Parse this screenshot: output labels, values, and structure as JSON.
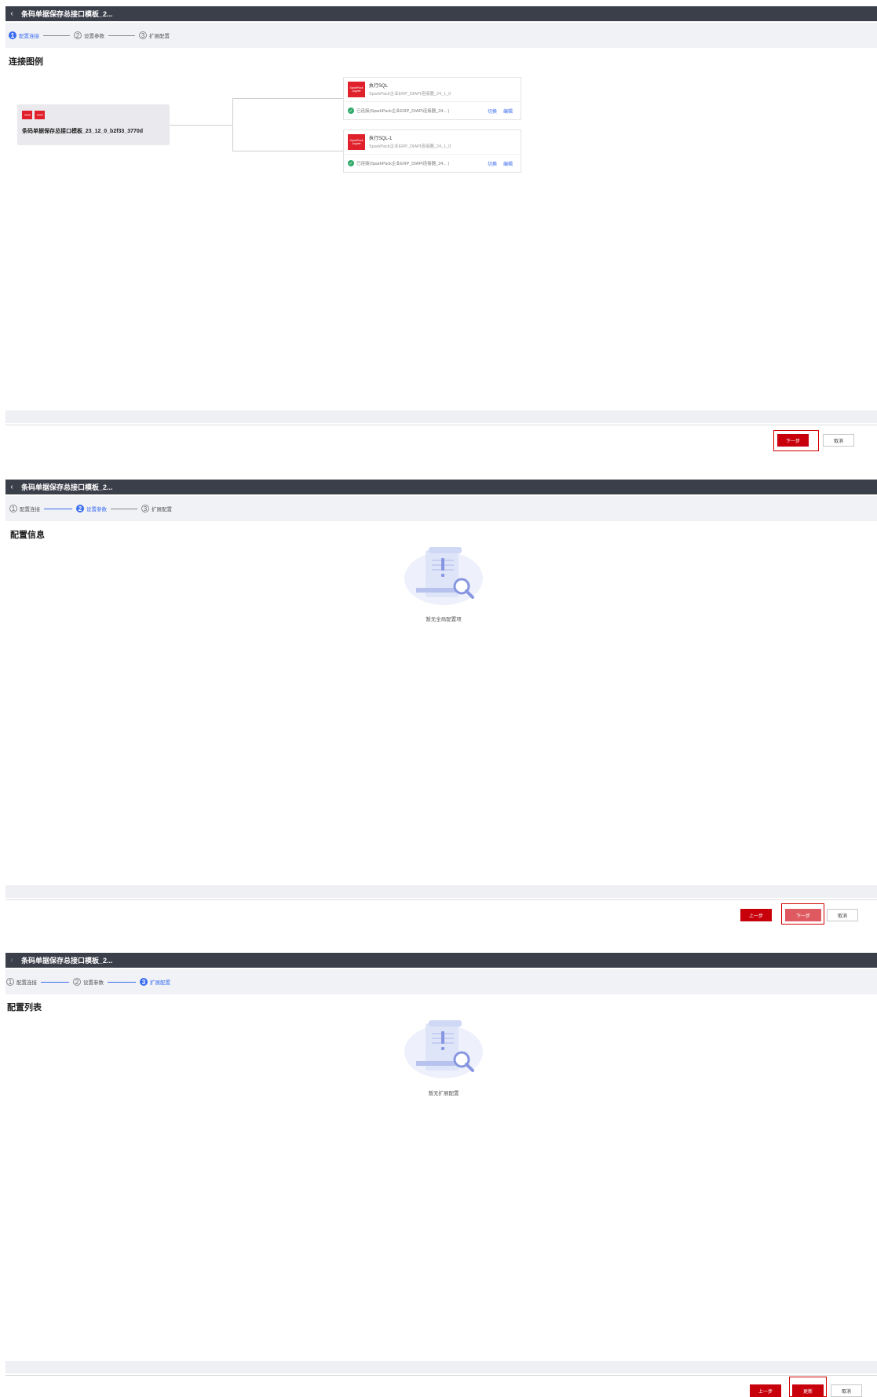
{
  "app_title": "条码单据保存总接口模板_2...",
  "steps": [
    "配置连接",
    "设置参数",
    "扩展配置"
  ],
  "step_numbers": [
    "1",
    "2",
    "3"
  ],
  "panel1": {
    "section_title": "连接图例",
    "source_node": "条码单据保存总接口模板_23_12_0_b2f33_3770d",
    "targets": [
      {
        "logo_line1": "SparkPack",
        "logo_line2": "Jupyter",
        "name": "执行SQL",
        "connector": "SparkPack企业ERP_DIAPI连接器_24_1_0",
        "status": "已连接(SparkPack企业ERP_DIAPI连接器_24... )",
        "switch_label": "切换",
        "edit_label": "编辑"
      },
      {
        "logo_line1": "SparkPack",
        "logo_line2": "Jupyter",
        "name": "执行SQL-1",
        "connector": "SparkPack企业ERP_DIAPI连接器_24_1_0",
        "status": "已连接(SparkPack企业ERP_DIAPI连接器_24... )",
        "switch_label": "切换",
        "edit_label": "编辑"
      }
    ],
    "next_label": "下一步",
    "cancel_label": "取消"
  },
  "panel2": {
    "section_title": "配置信息",
    "empty_text": "暂无全局配置项",
    "prev_label": "上一步",
    "next_label": "下一步",
    "cancel_label": "取消"
  },
  "panel3": {
    "section_title": "配置列表",
    "empty_text": "暂无扩展配置",
    "prev_label": "上一步",
    "update_label": "更新",
    "cancel_label": "取消"
  },
  "colors": {
    "primary_red": "#c8000b",
    "active_blue": "#3b6df0",
    "title_bar": "#3b3f4a",
    "success_green": "#2eaa68"
  },
  "icons": {
    "back": "chevron-left-icon",
    "empty": "empty-document-search-icon",
    "connected": "check-circle-icon"
  }
}
